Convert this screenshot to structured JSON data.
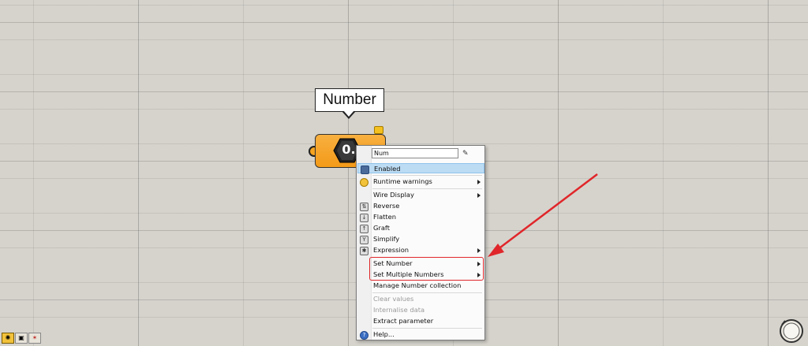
{
  "tooltip": {
    "text": "Number"
  },
  "component": {
    "badge": "0."
  },
  "menu": {
    "name_value": "Num",
    "items": [
      {
        "label": "Enabled"
      },
      {
        "label": "Runtime warnings"
      },
      {
        "label": "Wire Display"
      },
      {
        "label": "Reverse"
      },
      {
        "label": "Flatten"
      },
      {
        "label": "Graft"
      },
      {
        "label": "Simplify"
      },
      {
        "label": "Expression"
      },
      {
        "label": "Set Number"
      },
      {
        "label": "Set Multiple Numbers"
      },
      {
        "label": "Manage Number collection"
      },
      {
        "label": "Clear values"
      },
      {
        "label": "Internalise data"
      },
      {
        "label": "Extract parameter"
      },
      {
        "label": "Help..."
      }
    ]
  },
  "colors": {
    "highlight": "#bcdcf4",
    "annotation": "#e0262a",
    "component": "#f5a320"
  }
}
